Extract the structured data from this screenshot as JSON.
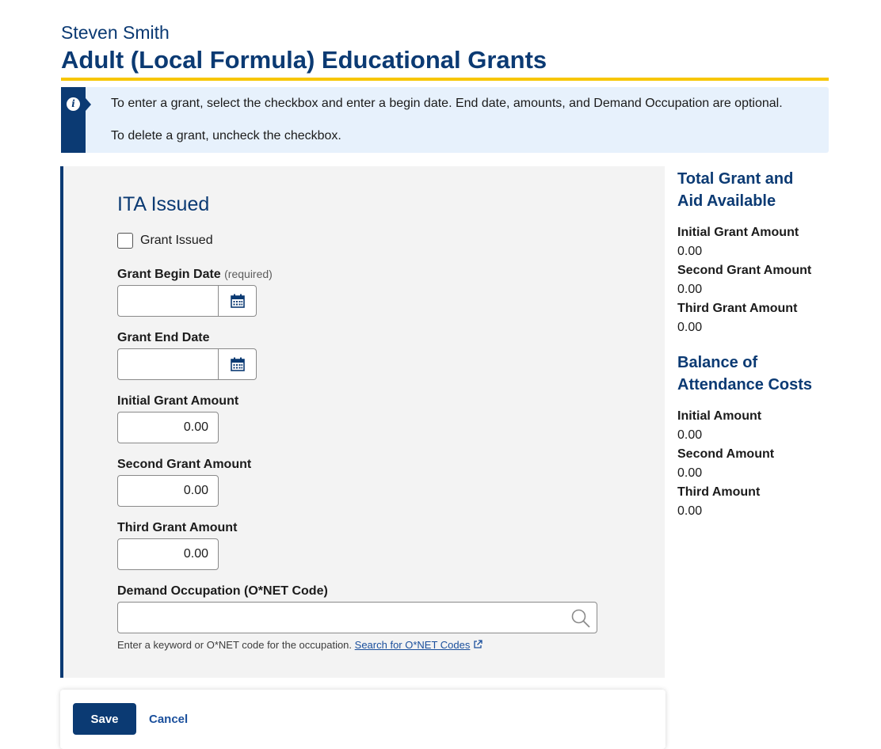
{
  "header": {
    "person_name": "Steven Smith",
    "page_title": "Adult (Local Formula) Educational Grants"
  },
  "alert": {
    "icon": "info-icon",
    "line1": "To enter a grant, select the checkbox and enter a begin date. End date, amounts, and Demand Occupation are optional.",
    "line2": "To delete a grant, uncheck the checkbox."
  },
  "form": {
    "section_title": "ITA Issued",
    "grant_issued_label": "Grant Issued",
    "grant_issued_checked": false,
    "begin_date_label": "Grant Begin Date",
    "begin_date_required": "(required)",
    "begin_date_value": "",
    "end_date_label": "Grant End Date",
    "end_date_value": "",
    "initial_amount_label": "Initial Grant Amount",
    "initial_amount_value": "0.00",
    "second_amount_label": "Second Grant Amount",
    "second_amount_value": "0.00",
    "third_amount_label": "Third Grant Amount",
    "third_amount_value": "0.00",
    "occupation_label": "Demand Occupation (O*NET Code)",
    "occupation_value": "",
    "hint_text": "Enter a keyword or O*NET code for the occupation.",
    "hint_link": "Search for O*NET Codes"
  },
  "footer": {
    "save_label": "Save",
    "cancel_label": "Cancel"
  },
  "sidebar": {
    "total_heading_line1": "Total Grant and",
    "total_heading_line2": "Aid Available",
    "total_items": [
      {
        "label": "Initial Grant Amount",
        "value": "0.00"
      },
      {
        "label": "Second Grant Amount",
        "value": "0.00"
      },
      {
        "label": "Third Grant Amount",
        "value": "0.00"
      }
    ],
    "balance_heading_line1": "Balance of",
    "balance_heading_line2": "Attendance Costs",
    "balance_items": [
      {
        "label": "Initial Amount",
        "value": "0.00"
      },
      {
        "label": "Second Amount",
        "value": "0.00"
      },
      {
        "label": "Third Amount",
        "value": "0.00"
      }
    ]
  },
  "colors": {
    "brand_navy": "#0b3a73",
    "accent_yellow": "#f7c600",
    "alert_bg": "#e7f1fc",
    "panel_bg": "#f3f3f3",
    "link_blue": "#1a4f9c"
  }
}
